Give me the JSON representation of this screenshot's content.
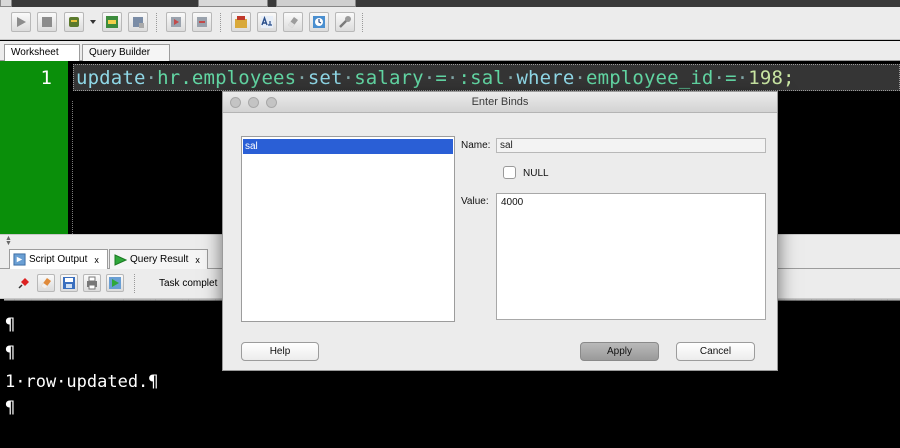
{
  "worksheet_tabs": [
    {
      "label": "Worksheet",
      "active": true
    },
    {
      "label": "Query Builder",
      "active": false
    }
  ],
  "editor": {
    "line_number": "1",
    "code": "update·hr.employees·set·salary·=·:sal·where·employee_id·=·198;"
  },
  "output_tabs": [
    {
      "label": "Script Output",
      "close": "x",
      "icon": "script-output-icon",
      "active": true
    },
    {
      "label": "Query Result",
      "close": "x",
      "icon": "run-arrow-icon",
      "active": false
    }
  ],
  "output_toolbar": {
    "status": "Task complet"
  },
  "output": {
    "dashes": "━━━━━━━━━━━━━━━━━━━━━━━━━━━━━━━━━━━━━━━━━━━━━━━━━━━━━━━━━━━━━━━━━━━━━━━━━━━━━━━━━━━━━━━━━━━━━━━━━━━━━━━━━━━━━━━━━━━━━━━━━━━━━━━━━━━━━━━━━━━━━━━━━━━━━━━━━━━━━━━━━━━━━━━━━━━━━━━━━━━━━━━━━━━━━━━━━",
    "lines": [
      "¶",
      "¶",
      "1·row·updated.¶",
      "¶"
    ]
  },
  "dialog": {
    "title": "Enter Binds",
    "binds": [
      "sal"
    ],
    "name_label": "Name:",
    "name_value": "sal",
    "null_label": "NULL",
    "null_checked": false,
    "value_label": "Value:",
    "value": "4000",
    "help_label": "Help",
    "apply_label": "Apply",
    "cancel_label": "Cancel"
  },
  "colors": {
    "gutter": "#0a8f0a",
    "code_text": "#62d6a3",
    "selection": "#2a5fd6"
  }
}
